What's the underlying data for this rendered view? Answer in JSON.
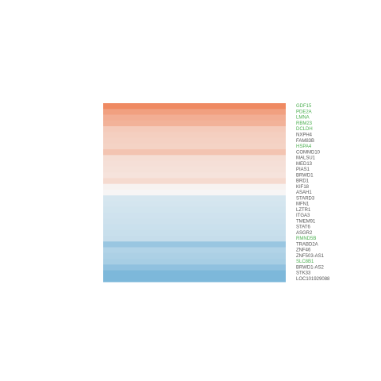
{
  "chart_data": {
    "type": "heatmap",
    "title": "",
    "xlabel": "",
    "ylabel": "",
    "rows": [
      {
        "label": "GDF15",
        "value": 3.0,
        "label_color": "#4caf50"
      },
      {
        "label": "PDE2A",
        "value": 2.4,
        "label_color": "#4caf50"
      },
      {
        "label": "LMNA",
        "value": 2.0,
        "label_color": "#4caf50"
      },
      {
        "label": "RBM23",
        "value": 1.9,
        "label_color": "#4caf50"
      },
      {
        "label": "DCLDH",
        "value": 1.2,
        "label_color": "#4caf50"
      },
      {
        "label": "NXPH4",
        "value": 1.1,
        "label_color": "#555555"
      },
      {
        "label": "FAM83B",
        "value": 1.05,
        "label_color": "#555555"
      },
      {
        "label": "HSPA4",
        "value": 1.0,
        "label_color": "#4caf50"
      },
      {
        "label": "COMMD10",
        "value": 1.4,
        "label_color": "#555555"
      },
      {
        "label": "MALSU1",
        "value": 0.7,
        "label_color": "#555555"
      },
      {
        "label": "MED13",
        "value": 0.65,
        "label_color": "#555555"
      },
      {
        "label": "PIAS1",
        "value": 0.6,
        "label_color": "#555555"
      },
      {
        "label": "BRWD1",
        "value": 0.55,
        "label_color": "#555555"
      },
      {
        "label": "BRD1",
        "value": 0.8,
        "label_color": "#555555"
      },
      {
        "label": "KIF18",
        "value": 0.15,
        "label_color": "#555555"
      },
      {
        "label": "ASAH1",
        "value": 0.05,
        "label_color": "#555555"
      },
      {
        "label": "STARD3",
        "value": -0.7,
        "label_color": "#555555"
      },
      {
        "label": "MFN1",
        "value": -0.75,
        "label_color": "#555555"
      },
      {
        "label": "LZTR1",
        "value": -0.8,
        "label_color": "#555555"
      },
      {
        "label": "ITGA3",
        "value": -0.85,
        "label_color": "#555555"
      },
      {
        "label": "TMEM91",
        "value": -0.9,
        "label_color": "#555555"
      },
      {
        "label": "STAT6",
        "value": -0.95,
        "label_color": "#555555"
      },
      {
        "label": "ASGR2",
        "value": -1.0,
        "label_color": "#555555"
      },
      {
        "label": "RMND5B",
        "value": -1.05,
        "label_color": "#4caf50"
      },
      {
        "label": "TRABD2A",
        "value": -2.0,
        "label_color": "#555555"
      },
      {
        "label": "ZNF46",
        "value": -1.5,
        "label_color": "#555555"
      },
      {
        "label": "ZNF503-AS1",
        "value": -1.6,
        "label_color": "#555555"
      },
      {
        "label": "SLC8B1",
        "value": -1.7,
        "label_color": "#4caf50"
      },
      {
        "label": "BRWD1-AS2",
        "value": -2.2,
        "label_color": "#555555"
      },
      {
        "label": "STK33",
        "value": -2.6,
        "label_color": "#555555"
      },
      {
        "label": "LOC101929088",
        "value": -2.6,
        "label_color": "#555555"
      }
    ],
    "color_scale": {
      "min": -3,
      "max": 3,
      "low_color": "#6aaed6",
      "mid_color": "#f7f7f7",
      "high_color": "#ef8a62"
    },
    "grid": false,
    "legend": "none"
  }
}
